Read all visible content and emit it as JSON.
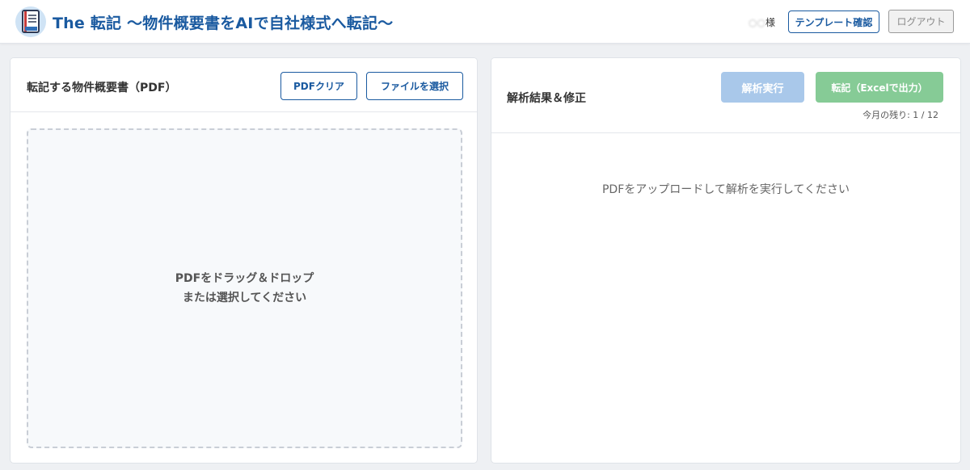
{
  "header": {
    "logo_icon": "document-book-icon",
    "title": "The 転記 〜物件概要書をAIで自社様式へ転記〜",
    "user_name_blurred": "○○",
    "user_suffix": "様",
    "template_button": "テンプレート確認",
    "logout_button": "ログアウト"
  },
  "left_panel": {
    "title": "転記する物件概要書（PDF）",
    "pdf_clear_button": "PDFクリア",
    "select_file_button": "ファイルを選択",
    "dropzone_line1": "PDFをドラッグ＆ドロップ",
    "dropzone_line2": "または選択してください"
  },
  "right_panel": {
    "title": "解析結果＆修正",
    "analyze_button": "解析実行",
    "transcribe_button": "転記（Excelで出力）",
    "remaining": "今月の残り: 1 / 12",
    "empty_message": "PDFをアップロードして解析を実行してください"
  },
  "colors": {
    "brand": "#1a5aa0",
    "analyze_disabled": "#a9c8ea",
    "transcribe_disabled": "#86cb96",
    "background": "#eef0f3"
  }
}
